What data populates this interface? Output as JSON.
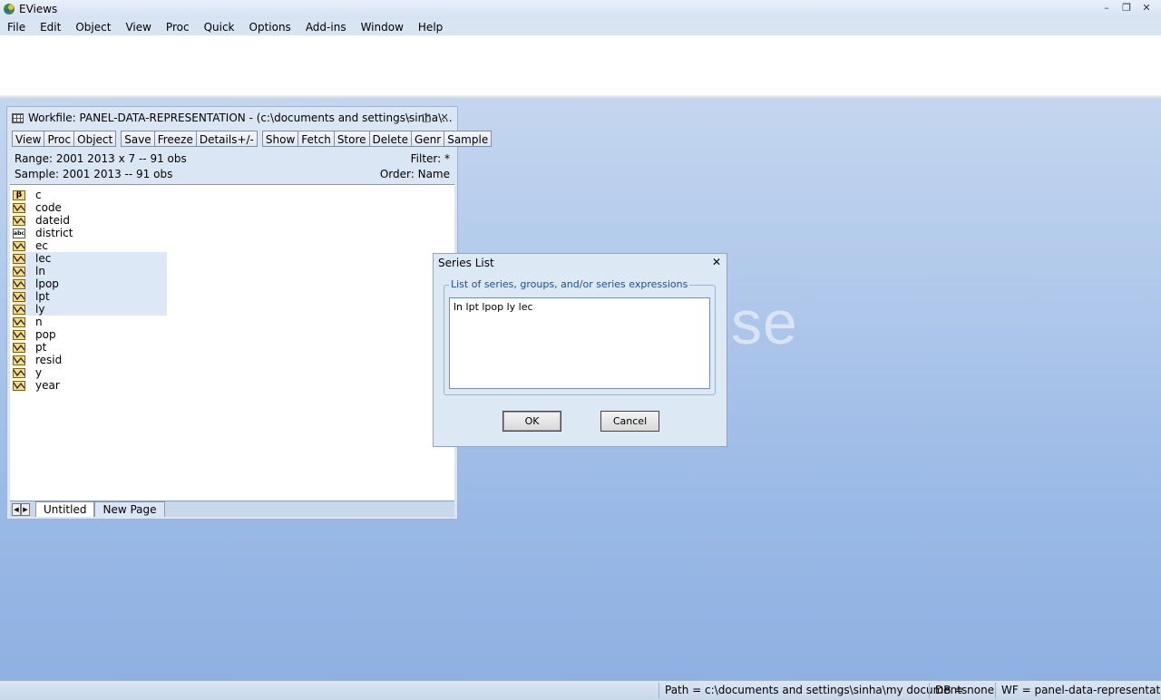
{
  "app": {
    "title": "EViews"
  },
  "menu": [
    "File",
    "Edit",
    "Object",
    "View",
    "Proc",
    "Quick",
    "Options",
    "Add-ins",
    "Window",
    "Help"
  ],
  "watermark": "se",
  "workfile": {
    "title": "Workfile: PANEL-DATA-REPRESENTATION - (c:\\documents and settings\\sinha\\...",
    "toolbar": [
      "View",
      "Proc",
      "Object",
      "Save",
      "Freeze",
      "Details+/-",
      "Show",
      "Fetch",
      "Store",
      "Delete",
      "Genr",
      "Sample"
    ],
    "range_label": "Range:  2001 2013 x 7   --   91 obs",
    "sample_label": "Sample: 2001 2013  --   91 obs",
    "filter_label": "Filter: *",
    "order_label": "Order: Name",
    "objects": [
      {
        "name": "c",
        "icon": "coef-icon",
        "selected": false
      },
      {
        "name": "code",
        "icon": "series-icon",
        "selected": false
      },
      {
        "name": "dateid",
        "icon": "series-icon",
        "selected": false
      },
      {
        "name": "district",
        "icon": "alpha-icon",
        "selected": false
      },
      {
        "name": "ec",
        "icon": "series-icon",
        "selected": false
      },
      {
        "name": "lec",
        "icon": "series-icon",
        "selected": true
      },
      {
        "name": "ln",
        "icon": "series-icon",
        "selected": true
      },
      {
        "name": "lpop",
        "icon": "series-icon",
        "selected": true
      },
      {
        "name": "lpt",
        "icon": "series-icon",
        "selected": true
      },
      {
        "name": "ly",
        "icon": "series-icon",
        "selected": true
      },
      {
        "name": "n",
        "icon": "series-icon",
        "selected": false
      },
      {
        "name": "pop",
        "icon": "series-icon",
        "selected": false
      },
      {
        "name": "pt",
        "icon": "series-icon",
        "selected": false
      },
      {
        "name": "resid",
        "icon": "series-icon",
        "selected": false
      },
      {
        "name": "y",
        "icon": "series-icon",
        "selected": false
      },
      {
        "name": "year",
        "icon": "series-icon",
        "selected": false
      }
    ],
    "tabs": {
      "active": "Untitled",
      "new": "New Page"
    }
  },
  "dialog": {
    "title": "Series List",
    "group_label": "List of series, groups, and/or series expressions",
    "text_value": "ln lpt lpop ly lec",
    "ok_label": "OK",
    "cancel_label": "Cancel"
  },
  "status": {
    "path": "Path = c:\\documents and settings\\sinha\\my documents",
    "db": "DB = none",
    "wf": "WF = panel-data-representation"
  },
  "colors": {
    "desktop_top": "#c4d6ef",
    "desktop_bottom": "#8fb1e2",
    "selection": "#dce8f6",
    "icon_fill": "#f6d98a"
  }
}
